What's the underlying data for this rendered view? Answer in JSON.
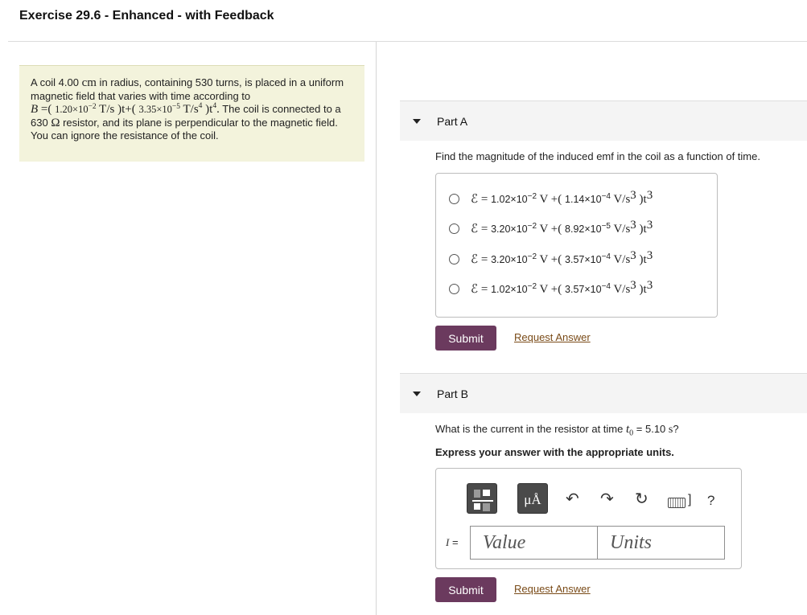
{
  "header": {
    "title": "Exercise 29.6 - Enhanced - with Feedback"
  },
  "problem": {
    "t1": "A coil 4.00 ",
    "u_cm": "cm",
    "t2": " in radius, containing 530 turns, is placed in a uniform magnetic field that varies with time according to",
    "B": "B",
    "eq_open": " =( ",
    "c1": "1.20×10",
    "c1_exp": "−2",
    "u1": " T/s",
    "mid": " )t+( ",
    "c2": "3.35×10",
    "c2_exp": "−5",
    "u2": " T/s",
    "u2_exp": "4",
    "end": " )t",
    "end_exp": "4",
    "end_dot": ".",
    "t3": " The coil is connected to a 630 ",
    "ohm": "Ω",
    "t4": " resistor, and its plane is perpendicular to the magnetic field. You can ignore the resistance of the coil."
  },
  "partA": {
    "title": "Part A",
    "question": "Find the magnitude of the induced emf in the coil as a function of time.",
    "options": [
      {
        "a": "1.02×10",
        "a_exp": "−2",
        "b": "1.14×10",
        "b_exp": "−4"
      },
      {
        "a": "3.20×10",
        "a_exp": "−2",
        "b": "8.92×10",
        "b_exp": "−5"
      },
      {
        "a": "3.20×10",
        "a_exp": "−2",
        "b": "3.57×10",
        "b_exp": "−4"
      },
      {
        "a": "1.02×10",
        "a_exp": "−2",
        "b": "3.57×10",
        "b_exp": "−4"
      }
    ],
    "eps": "ℰ",
    "eq": " = ",
    "unit_v": " V +( ",
    "unit_vs3": " V/s",
    "exp3": "3",
    "close": " )t",
    "submit": "Submit",
    "request": "Request Answer"
  },
  "partB": {
    "title": "Part B",
    "q1": "What is the current in the resistor at time ",
    "t0": "t",
    "t0_sub": "0",
    "q2": " = 5.10 ",
    "q_unit": "s",
    "q3": "?",
    "instruction": "Express your answer with the appropriate units.",
    "unit_button": "μÅ",
    "label_var": "I",
    "label_eq": " =",
    "value_placeholder": "Value",
    "units_placeholder": "Units",
    "help": "?",
    "submit": "Submit",
    "request": "Request Answer"
  },
  "icons": {
    "collapse": "triangle-down-icon",
    "undo": "undo-icon",
    "redo": "redo-icon",
    "reset": "reset-icon",
    "keyboard": "keyboard-icon",
    "help": "help-icon",
    "templates": "templates-icon"
  },
  "colors": {
    "submit_bg": "#6b3a5e",
    "link": "#7a4b18",
    "problem_bg": "#f3f3dc"
  }
}
